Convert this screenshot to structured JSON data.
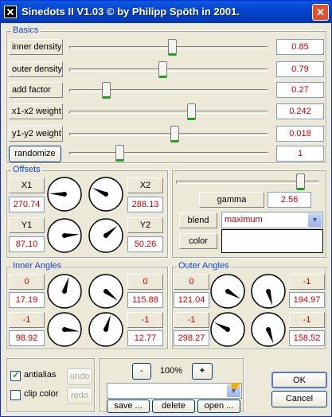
{
  "window": {
    "title": "Sinedots II V1.03 © by Philipp Spöth in 2001.",
    "close_glyph": "✕"
  },
  "basics": {
    "title": "Basics",
    "rows": [
      {
        "label": "inner density",
        "value": "0.85",
        "slider": 0.52
      },
      {
        "label": "outer density",
        "value": "0.79",
        "slider": 0.47
      },
      {
        "label": "add factor",
        "value": "0.27",
        "slider": 0.17
      },
      {
        "label": "x1-x2 weight",
        "value": "0.242",
        "slider": 0.62
      },
      {
        "label": "y1-y2 weight",
        "value": "0.018",
        "slider": 0.53
      }
    ],
    "randomize_label": "randomize",
    "randomize_value": "1",
    "randomize_slider": 0.24
  },
  "offsets": {
    "title": "Offsets",
    "x1_label": "X1",
    "x1_value": "270.74",
    "x2_label": "X2",
    "x2_value": "288.13",
    "y1_label": "Y1",
    "y1_value": "87.10",
    "y2_label": "Y2",
    "y2_value": "50.26"
  },
  "render": {
    "gamma_label": "gamma",
    "gamma_value": "2.56",
    "gamma_slider": 0.9,
    "blend_label": "blend",
    "blend_value": "maximum",
    "color_label": "color"
  },
  "inner_angles": {
    "title": "Inner Angles",
    "top_left": {
      "sign": "0",
      "value": "17.19"
    },
    "top_right": {
      "sign": "0",
      "value": "115.88"
    },
    "bottom_left": {
      "sign": "-1",
      "value": "98.92"
    },
    "bottom_right": {
      "sign": "-1",
      "value": "12.77"
    }
  },
  "outer_angles": {
    "title": "Outer Angles",
    "top_left": {
      "sign": "0",
      "value": "121.04"
    },
    "top_right": {
      "sign": "-1",
      "value": "194.97"
    },
    "bottom_left": {
      "sign": "-1",
      "value": "298.27"
    },
    "bottom_right": {
      "sign": "-1",
      "value": "158.52"
    }
  },
  "options": {
    "antialias_label": "antialias",
    "antialias_checked": true,
    "clip_label": "clip color",
    "clip_checked": false,
    "undo_label": "undo",
    "redo_label": "redo"
  },
  "presets": {
    "minus_label": "-",
    "zoom": "100%",
    "plus_label": "+",
    "save_label": "save ...",
    "delete_label": "delete",
    "open_label": "open ..."
  },
  "dialog": {
    "ok_label": "OK",
    "cancel_label": "Cancel"
  },
  "dials": [
    {
      "id": "offset-x1",
      "angle": 272
    },
    {
      "id": "offset-x2",
      "angle": 295
    },
    {
      "id": "offset-y1",
      "angle": 85
    },
    {
      "id": "offset-y2",
      "angle": 50
    },
    {
      "id": "inner-tl",
      "angle": 17
    },
    {
      "id": "inner-tr",
      "angle": 128
    },
    {
      "id": "inner-bl",
      "angle": 97
    },
    {
      "id": "inner-br",
      "angle": 18
    },
    {
      "id": "outer-tl",
      "angle": 121
    },
    {
      "id": "outer-tr",
      "angle": 164
    },
    {
      "id": "outer-bl",
      "angle": 298
    },
    {
      "id": "outer-br",
      "angle": 160
    }
  ]
}
